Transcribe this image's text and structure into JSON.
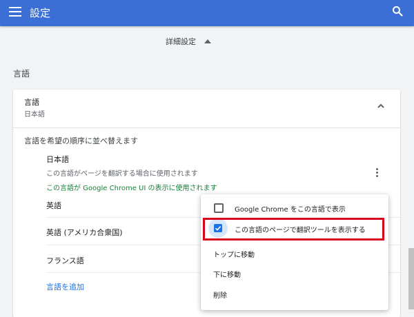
{
  "topbar": {
    "title": "設定",
    "menu_icon": "hamburger-menu-icon",
    "search_icon": "search-icon",
    "color": "#3c6fd6"
  },
  "advanced": {
    "label": "詳細設定",
    "icon": "caret-up-icon"
  },
  "section": {
    "heading": "言語"
  },
  "languages_card": {
    "header_title": "言語",
    "header_subtitle": "日本語",
    "order_label": "言語を希望の順序に並べ替えます",
    "japanese": {
      "name": "日本語",
      "description": "この言語がページを翻訳する場合に使用されます",
      "ui_note": "この言語が Google Chrome UI の表示に使用されます"
    },
    "rows": [
      {
        "name": "英語"
      },
      {
        "name": "英語 (アメリカ合衆国)"
      },
      {
        "name": "フランス語"
      }
    ],
    "add_language": "言語を追加"
  },
  "context_menu": {
    "items": [
      {
        "label": "Google Chrome をこの言語で表示",
        "checked": false
      },
      {
        "label": "この言語のページで翻訳ツールを表示する",
        "checked": true
      },
      {
        "label": "トップに移動"
      },
      {
        "label": "下に移動"
      },
      {
        "label": "削除"
      }
    ],
    "highlight_color": "#d9001b"
  }
}
